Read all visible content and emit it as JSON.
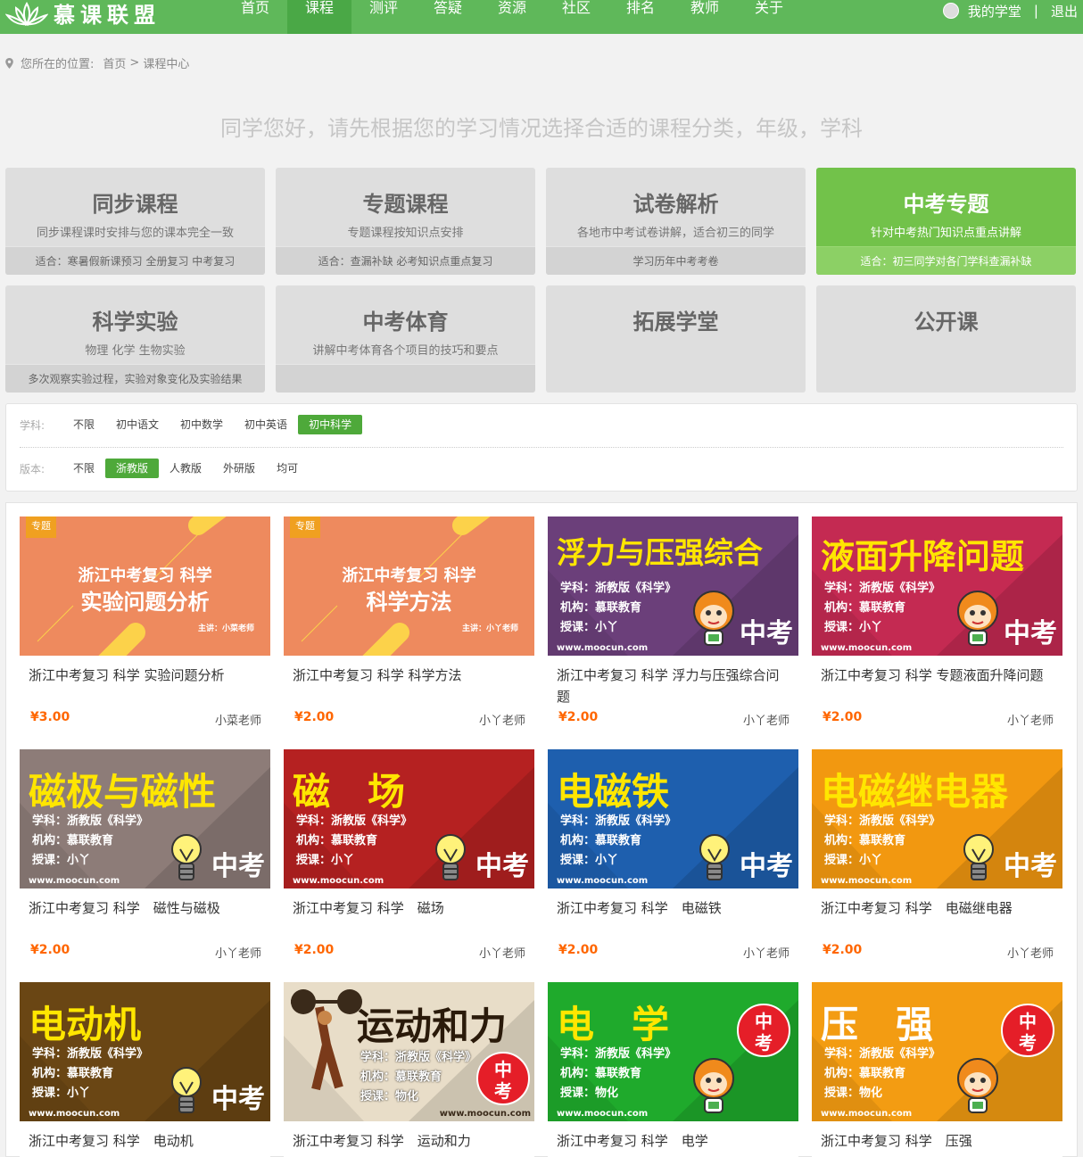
{
  "header": {
    "logo_text": "慕课联盟",
    "nav": [
      "首页",
      "课程",
      "测评",
      "答疑",
      "资源",
      "社区",
      "排名",
      "教师",
      "关于"
    ],
    "active_nav": 1,
    "my_study": "我的学堂",
    "separator": "|",
    "logout": "退出"
  },
  "breadcrumb": {
    "prefix": "您所在的位置:",
    "home": "首页",
    "sep": ">",
    "current": "课程中心"
  },
  "intro": "同学您好，请先根据您的学习情况选择合适的课程分类，年级，学科",
  "categories": [
    {
      "name": "同步课程",
      "desc": "同步课程课时安排与您的课本完全一致",
      "fit": "适合：寒暑假新课预习 全册复习 中考复习"
    },
    {
      "name": "专题课程",
      "desc": "专题课程按知识点安排",
      "fit": "适合：查漏补缺 必考知识点重点复习"
    },
    {
      "name": "试卷解析",
      "desc": "各地市中考试卷讲解，适合初三的同学",
      "fit": "学习历年中考考卷"
    },
    {
      "name": "中考专题",
      "desc": "针对中考热门知识点重点讲解",
      "fit": "适合：初三同学对各门学科查漏补缺"
    },
    {
      "name": "科学实验",
      "desc": "物理 化学 生物实验",
      "fit": "多次观察实验过程，实验对象变化及实验结果"
    },
    {
      "name": "中考体育",
      "desc": "讲解中考体育各个项目的技巧和要点",
      "fit": ""
    },
    {
      "name": "拓展学堂",
      "desc": "",
      "fit": ""
    },
    {
      "name": "公开课",
      "desc": "",
      "fit": ""
    }
  ],
  "active_category": 3,
  "filters": {
    "subject_label": "学科:",
    "subjects": [
      "不限",
      "初中语文",
      "初中数学",
      "初中英语",
      "初中科学"
    ],
    "subject_selected": 4,
    "edition_label": "版本:",
    "editions": [
      "不限",
      "浙教版",
      "人教版",
      "外研版",
      "均可"
    ],
    "edition_selected": 1
  },
  "courses": [
    {
      "title": "浙江中考复习 科学 实验问题分析",
      "price": "¥3.00",
      "teacher": "小菜老师",
      "thumb": {
        "style": "banner",
        "bg": "#ee8a5e",
        "tag": "专题",
        "line1": "浙江中考复习 科学",
        "line2": "实验问题分析",
        "lecturer": "主讲：小菜老师"
      }
    },
    {
      "title": "浙江中考复习 科学 科学方法",
      "price": "¥2.00",
      "teacher": "小丫老师",
      "thumb": {
        "style": "banner",
        "bg": "#ee8a5e",
        "tag": "专题",
        "line1": "浙江中考复习 科学",
        "line2": "科学方法",
        "lecturer": "主讲：小丫老师"
      }
    },
    {
      "title": "浙江中考复习 科学 浮力与压强综合问题",
      "price": "¥2.00",
      "teacher": "小丫老师",
      "thumb": {
        "style": "mascot",
        "bg": "#6b3f7a",
        "big": "浮力与压强综合",
        "bigcolor": "#ffe600",
        "subs": [
          "学科：浙教版《科学》",
          "机构：慕联教育",
          "授课：小丫"
        ],
        "zk": "中考",
        "url": "www.moocun.com"
      }
    },
    {
      "title": "浙江中考复习 科学 专题液面升降问题",
      "price": "¥2.00",
      "teacher": "小丫老师",
      "thumb": {
        "style": "mascot",
        "bg": "#c42a52",
        "big": "液面升降问题",
        "bigcolor": "#ffe600",
        "subs": [
          "学科：浙教版《科学》",
          "机构：慕联教育",
          "授课：小丫"
        ],
        "zk": "中考",
        "url": "www.moocun.com"
      }
    },
    {
      "title": "浙江中考复习 科学　磁性与磁极",
      "price": "¥2.00",
      "teacher": "小丫老师",
      "thumb": {
        "style": "bulb",
        "bg": "#8d7c78",
        "big": "磁极与磁性",
        "bigcolor": "#ffe600",
        "subs": [
          "学科：浙教版《科学》",
          "机构：慕联教育",
          "授课：小丫"
        ],
        "zk": "中考",
        "url": "www.moocun.com"
      }
    },
    {
      "title": "浙江中考复习 科学　磁场",
      "price": "¥2.00",
      "teacher": "小丫老师",
      "thumb": {
        "style": "bulb",
        "bg": "#b52121",
        "big": "磁　场",
        "bigcolor": "#ffe600",
        "subs": [
          "学科：浙教版《科学》",
          "机构：慕联教育",
          "授课：小丫"
        ],
        "zk": "中考",
        "url": "www.moocun.com"
      }
    },
    {
      "title": "浙江中考复习 科学　电磁铁",
      "price": "¥2.00",
      "teacher": "小丫老师",
      "thumb": {
        "style": "bulb",
        "bg": "#1e5fae",
        "big": "电磁铁",
        "bigcolor": "#ffe600",
        "subs": [
          "学科：浙教版《科学》",
          "机构：慕联教育",
          "授课：小丫"
        ],
        "zk": "中考",
        "url": "www.moocun.com"
      }
    },
    {
      "title": "浙江中考复习 科学　电磁继电器",
      "price": "¥2.00",
      "teacher": "小丫老师",
      "thumb": {
        "style": "bulb",
        "bg": "#f29810",
        "big": "电磁继电器",
        "bigcolor": "#ffe600",
        "subs": [
          "学科：浙教版《科学》",
          "机构：慕联教育",
          "授课：小丫"
        ],
        "zk": "中考",
        "url": "www.moocun.com"
      }
    },
    {
      "title": "浙江中考复习 科学　电动机",
      "price": "",
      "teacher": "",
      "thumb": {
        "style": "bulb",
        "bg": "#6a4614",
        "big": "电动机",
        "bigcolor": "#ffe600",
        "subs": [
          "学科：浙教版《科学》",
          "机构：慕联教育",
          "授课：小丫"
        ],
        "zk": "中考",
        "url": "www.moocun.com"
      }
    },
    {
      "title": "浙江中考复习 科学　运动和力",
      "price": "",
      "teacher": "",
      "thumb": {
        "style": "ink",
        "bg": "#e8ddc8",
        "big": "运动和力",
        "bigcolor": "#2a1a0a",
        "subs": [
          "学科：浙教版《科学》",
          "机构：慕联教育",
          "授课：物化"
        ],
        "circle": "中考",
        "url": "www.moocun.com"
      }
    },
    {
      "title": "浙江中考复习 科学　电学",
      "price": "",
      "teacher": "",
      "thumb": {
        "style": "mascot2",
        "bg": "#1faa2c",
        "big": "电　学",
        "bigcolor": "#ffe600",
        "subs": [
          "学科：浙教版《科学》",
          "机构：慕联教育",
          "授课：物化"
        ],
        "circle": "中考",
        "url": "www.moocun.com"
      }
    },
    {
      "title": "浙江中考复习 科学　压强",
      "price": "",
      "teacher": "",
      "thumb": {
        "style": "mascot2",
        "bg": "#f39c12",
        "big": "压　强",
        "bigcolor": "#fff",
        "subs": [
          "学科：浙教版《科学》",
          "机构：慕联教育",
          "授课：物化"
        ],
        "circle": "中考",
        "url": "www.moocun.com"
      }
    }
  ]
}
